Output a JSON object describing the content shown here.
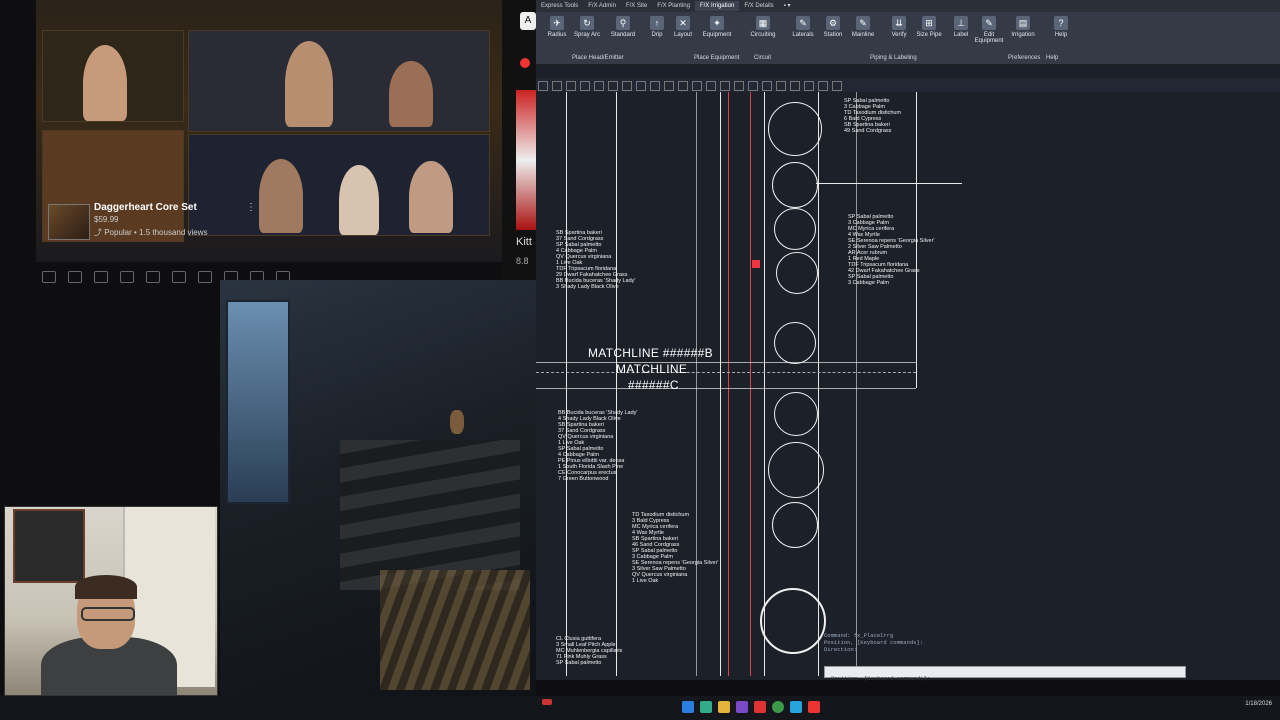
{
  "video": {
    "title": "Daggerheart Core Set",
    "price": "$59.99",
    "popular": "⤴ Popular • 1.5 thousand views",
    "kebab": "⋮"
  },
  "web": {
    "chip": "A",
    "kitt": "Kitt",
    "sub": "8.8"
  },
  "cad": {
    "tabs": [
      "Express Tools",
      "F/X Admin",
      "F/X Site",
      "F/X Planting",
      "F/X Irrigation",
      "F/X Details",
      "▪ ▾"
    ],
    "ribbon_buttons": [
      {
        "label": "Radius",
        "icon": "✈"
      },
      {
        "label": "Spray Arc",
        "icon": "↻"
      },
      {
        "label": "Standard",
        "icon": "⚲"
      },
      {
        "label": "Drip",
        "icon": "↑"
      },
      {
        "label": "Layout",
        "icon": "✕"
      },
      {
        "label": "Equipment",
        "icon": "✦"
      },
      {
        "label": "Circuiting",
        "icon": "▦"
      },
      {
        "label": "Laterals",
        "icon": "✎"
      },
      {
        "label": "Station",
        "icon": "⚙"
      },
      {
        "label": "Mainline",
        "icon": "✎"
      },
      {
        "label": "Verify",
        "icon": "⇊"
      },
      {
        "label": "Size Pipe",
        "icon": "⊞"
      },
      {
        "label": "Label",
        "icon": "⊥"
      },
      {
        "label": "Edit Equipment",
        "icon": "✎"
      },
      {
        "label": "Irrigation",
        "icon": "▤"
      },
      {
        "label": "Help",
        "icon": "?"
      }
    ],
    "groups": [
      "Place Head/Emitter",
      "Place Equipment",
      "Circuit",
      "Piping & Labeling",
      "Preferences",
      "Help"
    ],
    "matchline1": "MATCHLINE ######B",
    "matchline2": "MATCHLINE",
    "matchline3": "######C",
    "labels_top_right": [
      "SP Sabal palmetto",
      "3 Cabbage Palm",
      "TD Taxodium distichum",
      "6 Bald Cypress",
      "SB Spartina bakeri",
      "49 Sand Cordgrass"
    ],
    "labels_mid_right": [
      "SP Sabal palmetto",
      "3 Cabbage Palm",
      "MC Myrica cerifera",
      "4 Wax Myrtle",
      "SE Serenoa repens 'Georgia Silver'",
      "2 Silver Saw Palmetto",
      "AR Acer rubrum",
      "1 Red Maple",
      "TDF Tripsacum floridana",
      "42 Dwarf Fakahatchee Grass",
      "SP Sabal palmetto",
      "3 Cabbage Palm"
    ],
    "labels_left_upper": [
      "SB Spartina bakeri",
      "37 Sand Cordgrass",
      "SP Sabal palmetto",
      "4 Cabbage Palm",
      "QV Quercus virginiana",
      "1 Live Oak",
      "TDF Tripsacum floridana",
      "29 Dwarf Fakahatchee Grass",
      "BB Bucida buceras 'Shady Lady'",
      "3 Shady Lady Black Olive"
    ],
    "labels_left_lower": [
      "BB Bucida buceras 'Shady Lady'",
      "4 Shady Lady Black Olive",
      "SB Spartina bakeri",
      "37 Sand Cordgrass",
      "QV Quercus virginiana",
      "1 Live Oak",
      "SP Sabal palmetto",
      "4 Cabbage Palm",
      "PE Pinus elliottii var. densa",
      "1 South Florida Slash Pine",
      "CE Conocarpus erectus",
      "7 Green Buttonwood"
    ],
    "labels_center_lower": [
      "TD Taxodium distichum",
      "3 Bald Cypress",
      "MC Myrica cerifera",
      "4 Wax Myrtle",
      "SB Spartina bakeri",
      "46 Sand Cordgrass",
      "SP Sabal palmetto",
      "3 Cabbage Palm",
      "SE Serenoa repens 'Georgia Silver'",
      "3 Silver Saw Palmetto",
      "QV Quercus virginiana",
      "1 Live Oak"
    ],
    "labels_bottom_left": [
      "CL Clusia guttifera",
      "3 Small Leaf Pitch Apple",
      "MC Muhlenbergia capillaris",
      "71 Pink Muhly Grass",
      "SP Sabal palmetto"
    ],
    "command_lines": [
      "Command: fx_PlaceIrrg",
      "Position, [Keyboard commands]:",
      "Direction:"
    ],
    "command_prompt": "Position, [Keyboard commands]:"
  },
  "taskbar": {
    "time": "",
    "date": "1/18/2026"
  }
}
